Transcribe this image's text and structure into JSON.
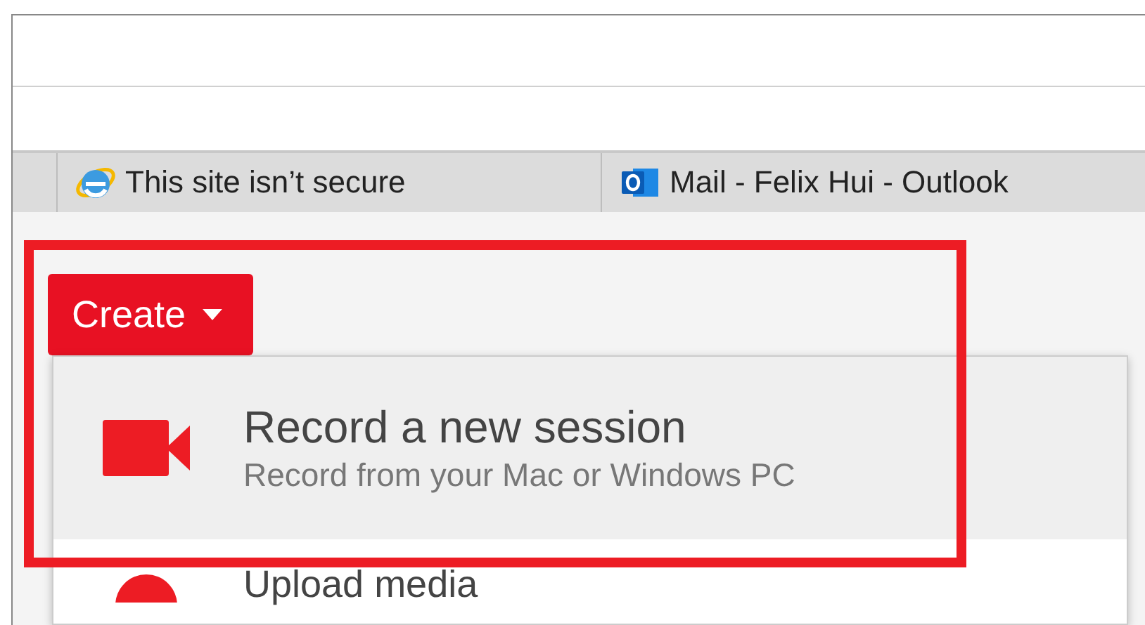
{
  "browser_tabs": [
    {
      "label": "This site isn’t secure",
      "kind": "ie"
    },
    {
      "label": "Mail - Felix Hui - Outlook",
      "kind": "outlook"
    }
  ],
  "create_button": {
    "label": "Create"
  },
  "menu": [
    {
      "title": "Record a new session",
      "subtitle": "Record from your Mac or Windows PC",
      "kind": "record",
      "highlighted": true
    },
    {
      "title": "Upload media",
      "kind": "upload",
      "highlighted": false
    }
  ],
  "annotation": {
    "visible": true
  }
}
